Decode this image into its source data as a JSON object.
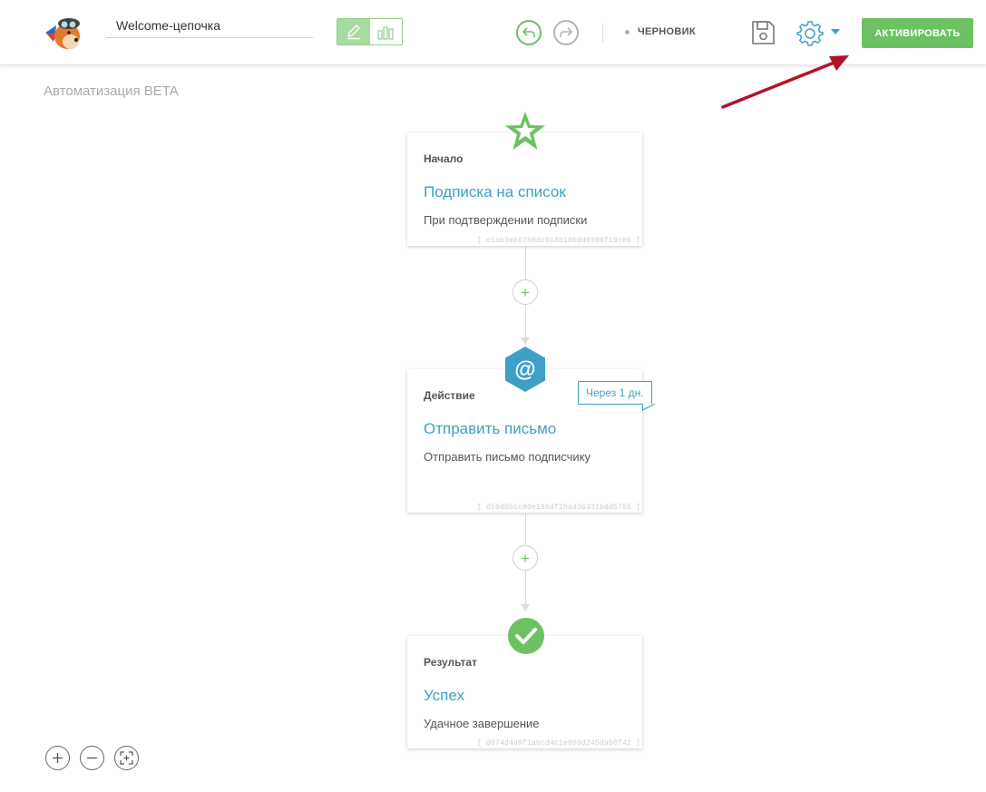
{
  "header": {
    "chain_name": "Welcome-цепочка",
    "status": "ЧЕРНОВИК",
    "activate_label": "АКТИВИРОВАТЬ",
    "mode_toggle": {
      "selected": "edit"
    }
  },
  "page": {
    "title": "Автоматизация BETA"
  },
  "flow": {
    "start": {
      "kind": "Начало",
      "name": "Подписка на список",
      "desc": "При подтверждении подписки",
      "id": "[ e1ab3e667b0dc618b18bdd0398f19c86 ]",
      "icon": "star-icon"
    },
    "add_step_1": {
      "label": "+"
    },
    "action": {
      "kind": "Действие",
      "name": "Отправить письмо",
      "desc": "Отправить письмо подписчику",
      "id": "[ d59d05cc90e196df2bad36331bdd5755 ]",
      "delay": "Через 1 дн.",
      "icon": "at-icon",
      "icon_glyph": "@"
    },
    "add_step_2": {
      "label": "+"
    },
    "result": {
      "kind": "Результат",
      "name": "Успех",
      "desc": "Удачное завершение",
      "id": "[ d074d4d9f1abcd4c1e000d245dab0f42 ]",
      "icon": "check-icon"
    }
  },
  "colors": {
    "accent_green": "#6cc163",
    "accent_blue": "#3ea0c6",
    "annotation_red": "#b0142a"
  }
}
